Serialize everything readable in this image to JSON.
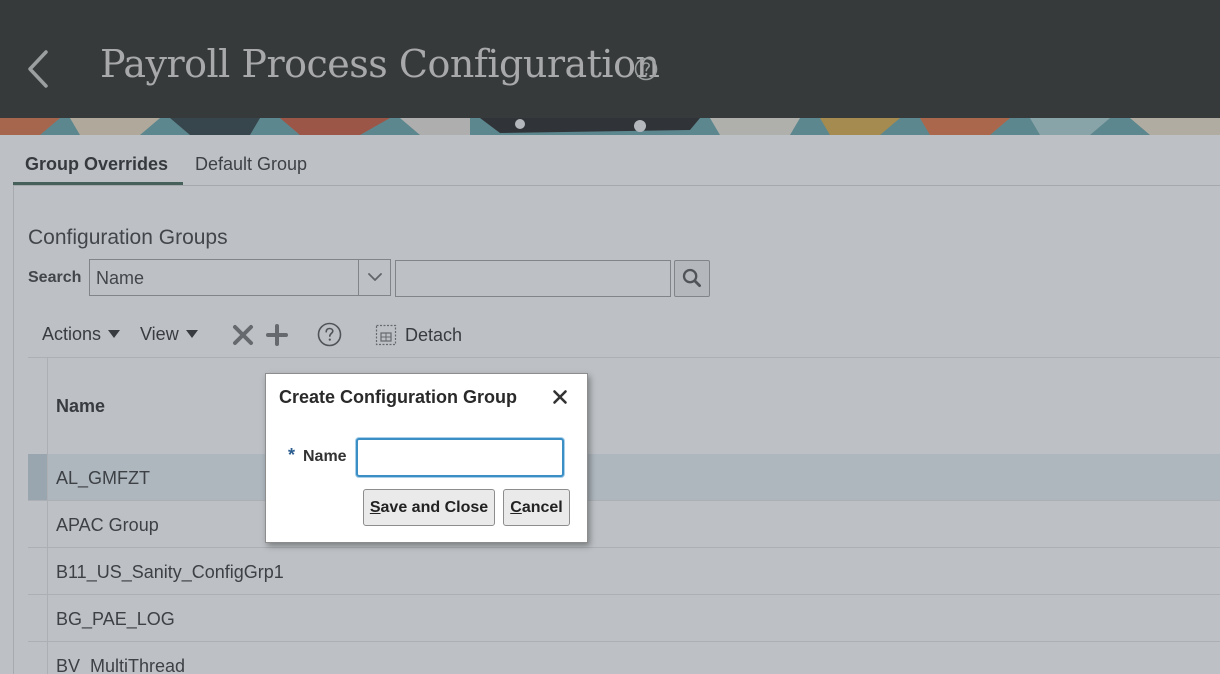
{
  "header": {
    "title": "Payroll Process Configuration",
    "background": "#201e1a",
    "title_color": "#dcd8d2",
    "back_icon": "chevron-left-icon",
    "help_icon": "question-circle-icon"
  },
  "tabs": [
    {
      "label": "Group Overrides",
      "active": true
    },
    {
      "label": "Default Group",
      "active": false
    }
  ],
  "main": {
    "section_title": "Configuration Groups",
    "search": {
      "label": "Search",
      "field_value": "Name",
      "query_value": "",
      "button_icon": "search-icon"
    },
    "toolbar": {
      "actions_label": "Actions",
      "view_label": "View",
      "delete_icon": "close-icon",
      "add_icon": "plus-icon",
      "help_icon": "question-circle-icon",
      "detach_icon": "detach-icon",
      "detach_label": "Detach"
    },
    "table": {
      "column_header": "Name",
      "rows": [
        {
          "name": "AL_GMFZT",
          "selected": true
        },
        {
          "name": "APAC Group",
          "selected": false
        },
        {
          "name": "B11_US_Sanity_ConfigGrp1",
          "selected": false
        },
        {
          "name": "BG_PAE_LOG",
          "selected": false
        },
        {
          "name": "BV_MultiThread",
          "selected": false
        }
      ]
    }
  },
  "dialog": {
    "title": "Create Configuration Group",
    "close_icon": "close-icon",
    "required_marker": "*",
    "name_label": "Name",
    "name_value": "",
    "save_prefix": "S",
    "save_rest": "ave and Close",
    "cancel_prefix": "C",
    "cancel_rest": "ancel"
  },
  "colors": {
    "accent": "#3a5f4e",
    "focus": "#3c8fc4",
    "selected_row": "#e6eef4"
  }
}
